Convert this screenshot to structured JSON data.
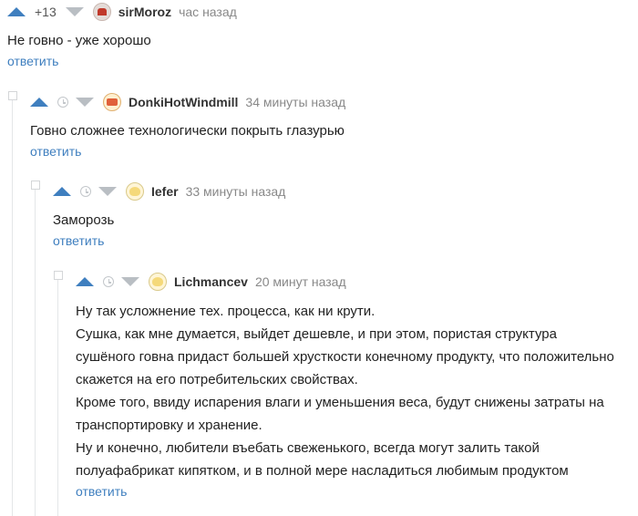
{
  "comments": [
    {
      "score": "+13",
      "author": "sirMoroz",
      "time": "час назад",
      "avatar_icon": "user-avatar-icon",
      "text": [
        "Не говно - уже хорошо"
      ],
      "reply_label": "ответить"
    },
    {
      "score": "",
      "author": "DonkiHotWindmill",
      "time": "34 минуты назад",
      "avatar_icon": "user-avatar-icon",
      "text": [
        "Говно сложнее технологически покрыть глазурью"
      ],
      "reply_label": "ответить"
    },
    {
      "score": "",
      "author": "Iefer",
      "time": "33 минуты назад",
      "avatar_icon": "user-avatar-icon",
      "text": [
        "Заморозь"
      ],
      "reply_label": "ответить"
    },
    {
      "score": "",
      "author": "Lichmancev",
      "time": "20 минут назад",
      "avatar_icon": "user-avatar-icon",
      "text": [
        "Ну так усложнение тех. процесса, как ни крути.",
        "Сушка, как мне думается, выйдет дешевле, и при этом, пористая структура сушёного говна придаст большей хрусткости конечному продукту, что положительно скажется на его потребительских свойствах.",
        "Кроме того, ввиду испарения влаги и уменьшения веса, будут снижены затраты на транспортировку и хранение.",
        "Ну и конечно, любители въебать свеженького, всегда могут залить такой полуафабрикат кипятком, и в полной мере насладиться любимым продуктом"
      ],
      "reply_label": "ответить"
    }
  ],
  "colors": {
    "accent": "#3f7fbf",
    "muted": "#888888"
  }
}
